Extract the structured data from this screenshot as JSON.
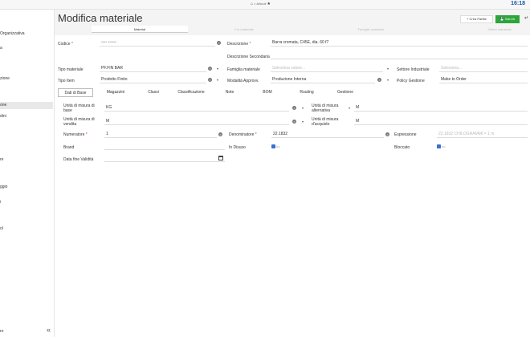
{
  "topbar": {
    "home_icon": "home-icon",
    "breadcrumb": "> Articoli",
    "star_icon": "star-icon",
    "clock": "16:18"
  },
  "sidebar": {
    "items": [
      {
        "label": "Organizzativa"
      },
      {
        "label": "a"
      },
      {
        "label": "zione"
      },
      {
        "label": "one",
        "active": true
      },
      {
        "label": "dini"
      },
      {
        "label": "re"
      },
      {
        "label": "ggio"
      },
      {
        "label": "i"
      },
      {
        "label": "ol"
      },
      {
        "label": "ro"
      }
    ],
    "collapse_icon": "«"
  },
  "header": {
    "title": "Modifica materiale",
    "crea_label": "+ Crea Partite",
    "salva_label": "SALVA",
    "more_icon": "↵"
  },
  "main_tabs": [
    {
      "label": "Material",
      "selected": true
    },
    {
      "label": "Fur materiale"
    },
    {
      "label": "Famiglie materiale"
    },
    {
      "label": "Settori industriali"
    }
  ],
  "fields": {
    "codice": {
      "label": "Codice",
      "value": "•••• ••••••"
    },
    "descrizione": {
      "label": "Descrizione",
      "value": "Barra cromata, C45E, dia. 60 f7"
    },
    "descrizione_sec": {
      "label": "Descrizione Secondaria",
      "value": ""
    },
    "tipo_materiale": {
      "label": "Tipo materiale",
      "value": "PF.FIN BAR"
    },
    "famiglia": {
      "label": "Famiglia materiale",
      "placeholder": "Seleziona valore..."
    },
    "settore": {
      "label": "Settore Industriale",
      "placeholder": "Seleziona..."
    },
    "tipo_item": {
      "label": "Tipo Item",
      "value": "Prodotto Finito"
    },
    "modalita": {
      "label": "Modalità Approvv.",
      "value": "Produzione Interna"
    },
    "policy": {
      "label": "Policy Gestione",
      "value": "Make to Order"
    }
  },
  "sub_tabs": [
    {
      "label": "Dati di Base",
      "selected": true
    },
    {
      "label": "Magazzini"
    },
    {
      "label": "Classi"
    },
    {
      "label": "Classificazione"
    },
    {
      "label": "Note"
    },
    {
      "label": "BOM"
    },
    {
      "label": "Routing"
    },
    {
      "label": "Gestione"
    }
  ],
  "base": {
    "um_base": {
      "label": "Unità di misura di base",
      "value": "KG"
    },
    "um_alt": {
      "label": "Unità di misura alternativa",
      "value": "M"
    },
    "um_vendita": {
      "label": "Unità di misura di vendita",
      "value": "M"
    },
    "um_acquisto": {
      "label": "Unità di misura d'acquisto",
      "value": "M"
    },
    "numeratore": {
      "label": "Numeratore",
      "value": "1"
    },
    "denominatore": {
      "label": "Denominatore",
      "value": "22.1832"
    },
    "espressione": {
      "label": "Espressione",
      "value": "22.1832 CHILOGRAMMI = 1 m"
    },
    "brand": {
      "label": "Brand",
      "value": ""
    },
    "in_disuso": {
      "label": "In Disuso",
      "note": "NO"
    },
    "bloccato": {
      "label": "Bloccato",
      "note": "NO"
    },
    "data_fine": {
      "label": "Data fine Validità",
      "value": ""
    }
  }
}
